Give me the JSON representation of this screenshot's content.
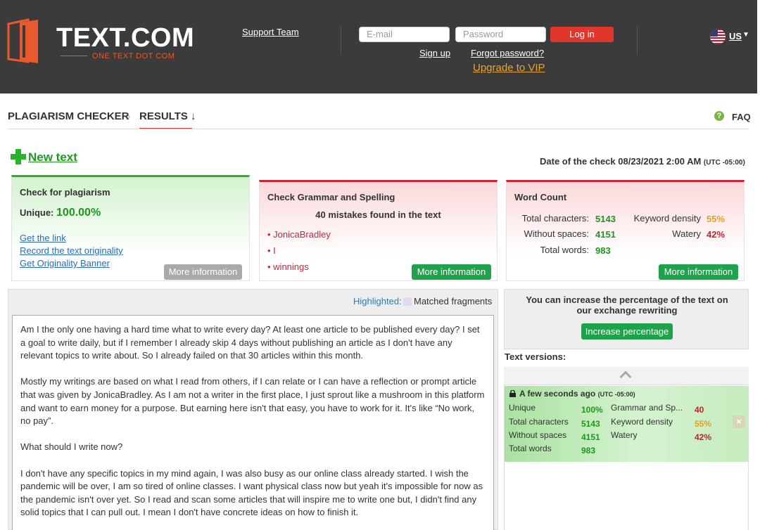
{
  "header": {
    "logo_text": "TEXT.COM",
    "logo_sub": "ONE TEXT DOT COM",
    "support": "Support Team",
    "email_placeholder": "E-mail",
    "password_placeholder": "Password",
    "login": "Log in",
    "signup": "Sign up",
    "forgot": "Forgot password?",
    "vip": "Upgrade to VIP",
    "lang": "US"
  },
  "breadcrumb": {
    "root": "PLAGIARISM CHECKER",
    "sep": "›",
    "active": "RESULTS ↓",
    "faq": "FAQ",
    "faq_icon": "?"
  },
  "toolbar": {
    "new_text": "New text",
    "date_label": "Date of the check 08/23/2021 2:00 AM",
    "date_tz": "(UTC -05:00)"
  },
  "plagiarism": {
    "title": "Check for plagiarism",
    "unique_label": "Unique:",
    "unique_value": "100.00%",
    "links": [
      "Get the link",
      "Record the text originality",
      "Get Originality Banner"
    ],
    "more": "More information"
  },
  "grammar": {
    "title": "Check Grammar and Spelling",
    "summary": "40 mistakes found in the text",
    "mistakes": [
      "• JonicaBradley",
      "• I",
      "• winnings"
    ],
    "more": "More information"
  },
  "wordcount": {
    "title": "Word Count",
    "total_chars_label": "Total characters:",
    "total_chars": "5143",
    "without_spaces_label": "Without spaces:",
    "without_spaces": "4151",
    "total_words_label": "Total words:",
    "total_words": "983",
    "keyword_label": "Keyword density",
    "keyword": "55%",
    "watery_label": "Watery",
    "watery": "42%",
    "more": "More information"
  },
  "legend": {
    "highlighted": "Highlighted:",
    "matched": "Matched fragments",
    "swatch_color": "#e6d7f2"
  },
  "text_paragraphs": [
    "Am I the only one having a hard time what to write every day? At least one article to be published every day? I set a goal to write daily, but if I remember I already skip 4 days without publishing an article as I don't have any relevant topics to write about. So I already failed on that 30 articles within this month.",
    "Mostly my writings are based on what I read from others, if I can relate or I can have a reflection or prompt article that was given by JonicaBradley. As I am not a writer in the first place, I just sprout like a mushroom in this platform and want to earn money for a purpose. But earning here isn't that easy, you have to work for it. It's like “No work, no pay”.",
    "What should I write now?",
    "I don't have any specific topics in my mind again, I was also busy as our online class already started. I wish the pandemic will be over, I am so tired of online classes. I want physical class now but yeah it's impossible for now as the pandemic isn't over yet. So I read and scan some articles that will inspire me to write one but, I didn't find any solid topics that I can pull out. I mean I don't have concrete ideas on how to finish it."
  ],
  "increase": {
    "text": "You can increase the percentage of the text on our exchange rewriting",
    "button": "Increase percentage"
  },
  "versions": {
    "title": "Text versions:",
    "time": "A few seconds ago",
    "tz": "(UTC -05:00)",
    "unique_label": "Unique",
    "unique": "100%",
    "total_chars_label": "Total characters",
    "total_chars": "5143",
    "without_spaces_label": "Without spaces",
    "without_spaces": "4151",
    "total_words_label": "Total words",
    "total_words": "983",
    "grammar_label": "Grammar and Sp...",
    "grammar": "40",
    "keyword_label": "Keyword density",
    "keyword": "55%",
    "watery_label": "Watery",
    "watery": "42%",
    "close": "×"
  },
  "colors": {
    "header_bg": "#3b3b3b",
    "accent_red": "#e0362b",
    "green": "#1fa34a",
    "vip_orange": "#e9a52b"
  }
}
